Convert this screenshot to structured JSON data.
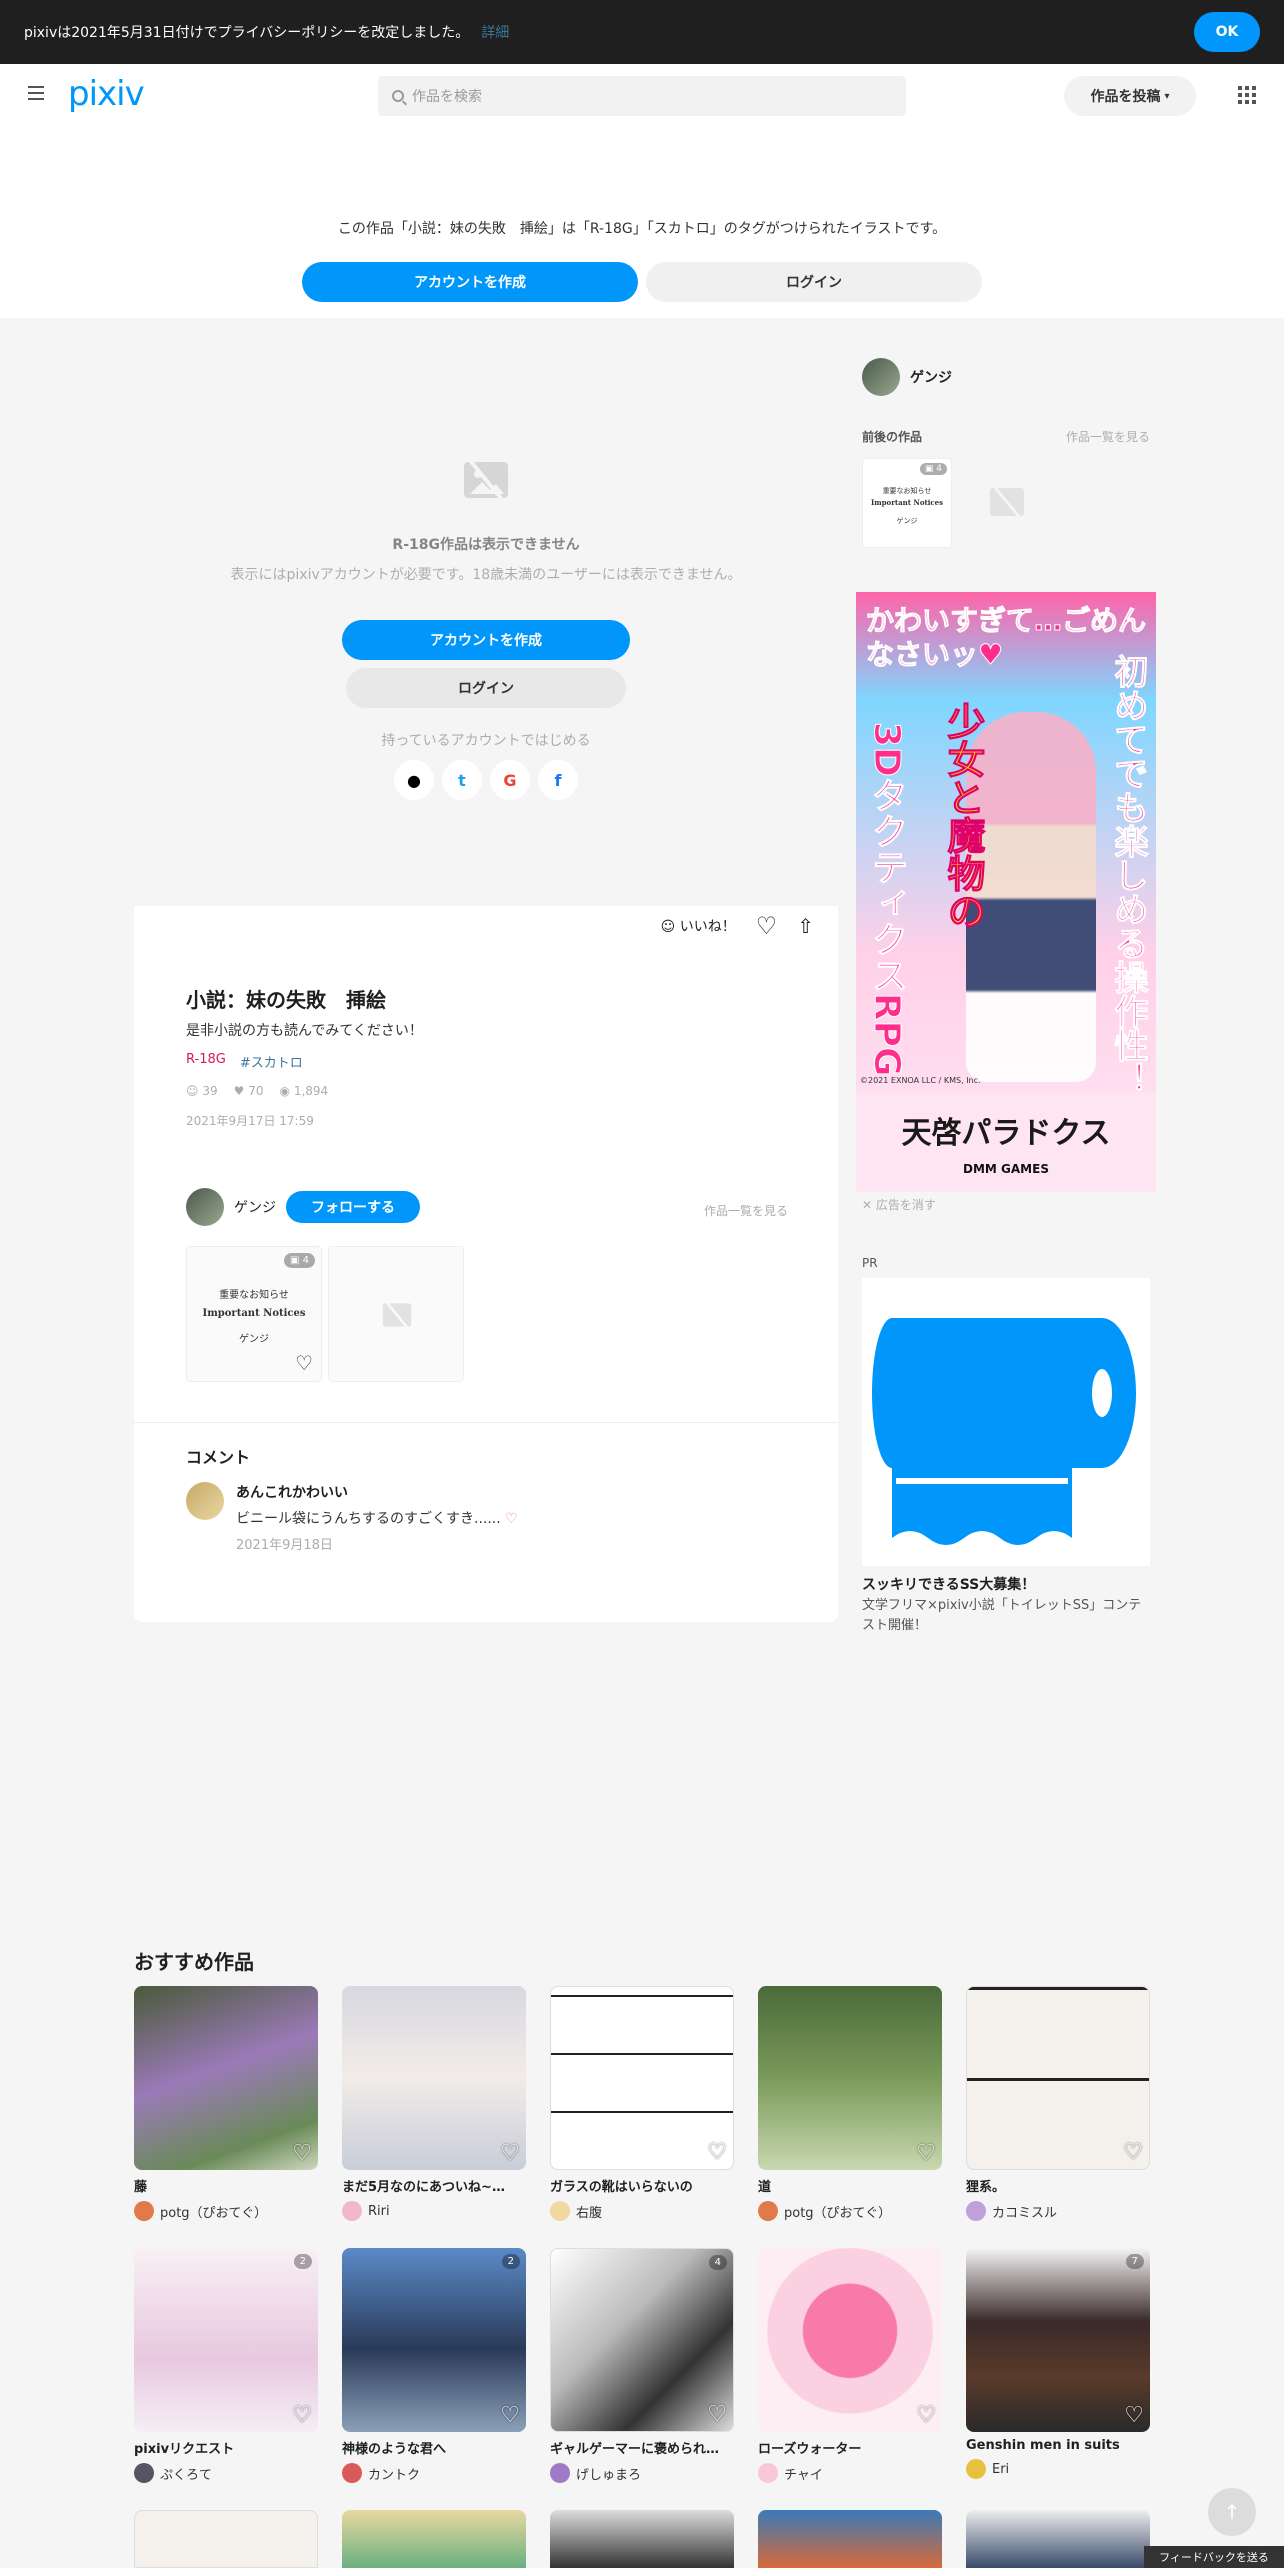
{
  "notice": {
    "text": "pixivは2021年5月31日付けでプライバシーポリシーを改定しました。",
    "link": "詳細",
    "ok": "OK"
  },
  "header": {
    "logo": "pixiv",
    "search_placeholder": "作品を検索",
    "post_label": "作品を投稿"
  },
  "warning": {
    "message": "この作品「小説：妹の失敗　挿絵」は「R-18G」「スカトロ」のタグがつけられたイラストです。",
    "create_account": "アカウントを作成",
    "login": "ログイン"
  },
  "blocked": {
    "title": "R-18G作品は表示できません",
    "subtitle": "表示にはpixivアカウントが必要です。18歳未満のユーザーには表示できません。",
    "create_account": "アカウントを作成",
    "login": "ログイン",
    "start_with": "持っているアカウントではじめる",
    "social": [
      "",
      "t",
      "G",
      "f"
    ]
  },
  "work": {
    "like_label": "いいね！",
    "title": "小説：妹の失敗　挿絵",
    "description": "是非小説の方も読んでみてください！",
    "tags": [
      "R-18G",
      "#スカトロ"
    ],
    "stats": {
      "likes": "39",
      "bookmarks": "70",
      "views": "1,894"
    },
    "date": "2021年9月17日 17:59"
  },
  "author": {
    "name": "ゲンジ",
    "follow": "フォローする",
    "see_all": "作品一覧を見る"
  },
  "author_works": [
    {
      "badge": "4",
      "lines": [
        "重要なお知らせ",
        "Important Notices",
        "ゲンジ"
      ]
    }
  ],
  "comments": {
    "title": "コメント",
    "items": [
      {
        "name": "あんこれかわいい",
        "text": "ビニール袋にうんちするのすごくすき......",
        "date": "2021年9月18日"
      }
    ]
  },
  "sidebar": {
    "user": "ゲンジ",
    "neighbors_label": "前後の作品",
    "see_all": "作品一覧を見る",
    "mini_badge": "4",
    "mini_lines": [
      "重要なお知らせ",
      "Important Notices",
      "ゲンジ"
    ],
    "ad": {
      "headline": "かわいすぎて…ごめんなさいッ♥",
      "right_vertical": "初めてでも楽しめる操作性！",
      "mid_vertical": "少女と魔物の",
      "left_vertical": "3DタクティクスRPG",
      "copyright": "©2021 EXNOA LLC / KMS, Inc.",
      "game_title": "天啓パラドクス",
      "publisher": "DMM GAMES"
    },
    "ad_close": "広告を消す",
    "pr_label": "PR",
    "pr_title": "スッキリできるSS大募集！",
    "pr_desc": "文学フリマ×pixiv小説「トイレットSS」コンテスト開催！"
  },
  "recommended": {
    "title": "おすすめ作品",
    "items": [
      {
        "title": "藤",
        "author": "potg（ぴおてぐ）",
        "badge": ""
      },
      {
        "title": "まだ5月なのにあついね~…",
        "author": "Riri",
        "badge": ""
      },
      {
        "title": "ガラスの靴はいらないの",
        "author": "右腹",
        "badge": ""
      },
      {
        "title": "道",
        "author": "potg（ぴおてぐ）",
        "badge": ""
      },
      {
        "title": "狸系。",
        "author": "カコミスル",
        "badge": ""
      },
      {
        "title": "pixivリクエスト",
        "author": "ぷくろて",
        "badge": "2"
      },
      {
        "title": "神様のような君へ",
        "author": "カントク",
        "badge": "2"
      },
      {
        "title": "ギャルゲーマーに褒められ…",
        "author": "げしゅまろ",
        "badge": "4"
      },
      {
        "title": "ローズウォーター",
        "author": "チャイ",
        "badge": ""
      },
      {
        "title": "Genshin men in suits",
        "author": "Eri",
        "badge": "7"
      }
    ]
  },
  "feedback": "フィードバックを送る",
  "colors": {
    "accent": "#0096fa",
    "r18": "#d8185d",
    "tag": "#3d7699"
  }
}
